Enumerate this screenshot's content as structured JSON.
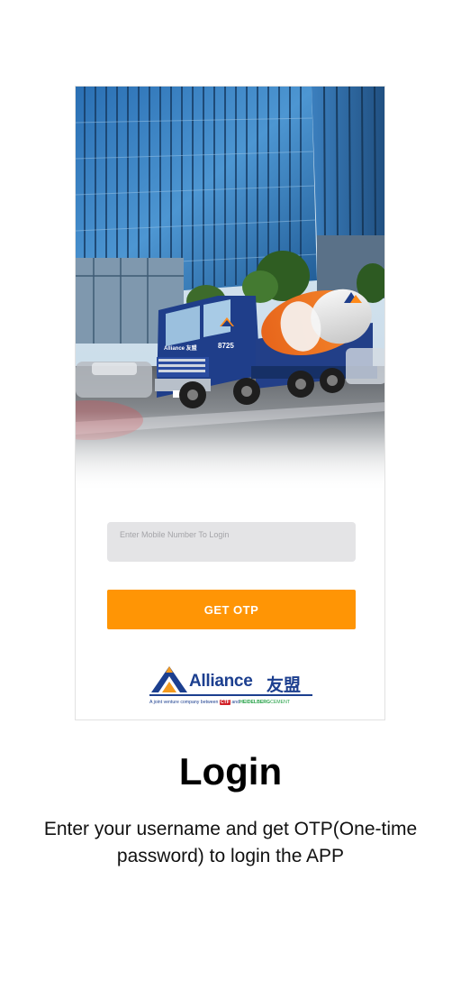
{
  "login_form": {
    "mobile_placeholder": "Enter Mobile Number To Login",
    "mobile_value": "",
    "get_otp_label": "GET OTP"
  },
  "brand": {
    "wordmark": "Alliance",
    "chinese_name": "友盟",
    "tagline_prefix": "A joint venture company between",
    "tagline_partner_1_mark": "CTF",
    "tagline_and": "and",
    "tagline_partner_2_name": "HEIDELBERG",
    "tagline_partner_2_suffix": "CEMENT",
    "primary_color": "#1c3f8f",
    "accent_color": "#ff9505"
  },
  "hero": {
    "truck_plate": "8725",
    "truck_brand": "Alliance 友盟"
  },
  "page": {
    "title": "Login",
    "description": "Enter your username and get OTP(One-time password) to login the APP"
  }
}
